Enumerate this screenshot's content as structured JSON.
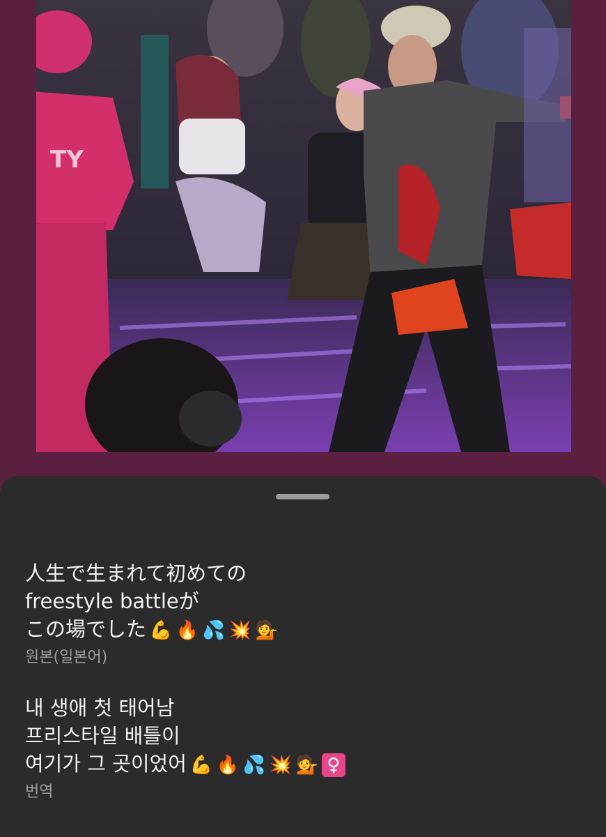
{
  "original": {
    "lines": [
      "人生で生まれて初めての",
      "freestyle battleが",
      "この場でした"
    ],
    "emojis": [
      "💪",
      "🔥",
      "💦",
      "💥",
      "💁"
    ],
    "label": "원본(일본어)"
  },
  "translation": {
    "lines": [
      "내 생애 첫 태어남",
      "프리스타일 배틀이",
      "여기가 그 곳이었어"
    ],
    "emojis": [
      "💪",
      "🔥",
      "💦",
      "💥",
      "💁",
      "♀"
    ],
    "label": "번역"
  },
  "colors": {
    "frame": "#5b1f3f",
    "sheet": "#2b2b2b",
    "text": "#f2f2f2",
    "muted": "#9e9e9e",
    "venus": "#e8468a"
  }
}
